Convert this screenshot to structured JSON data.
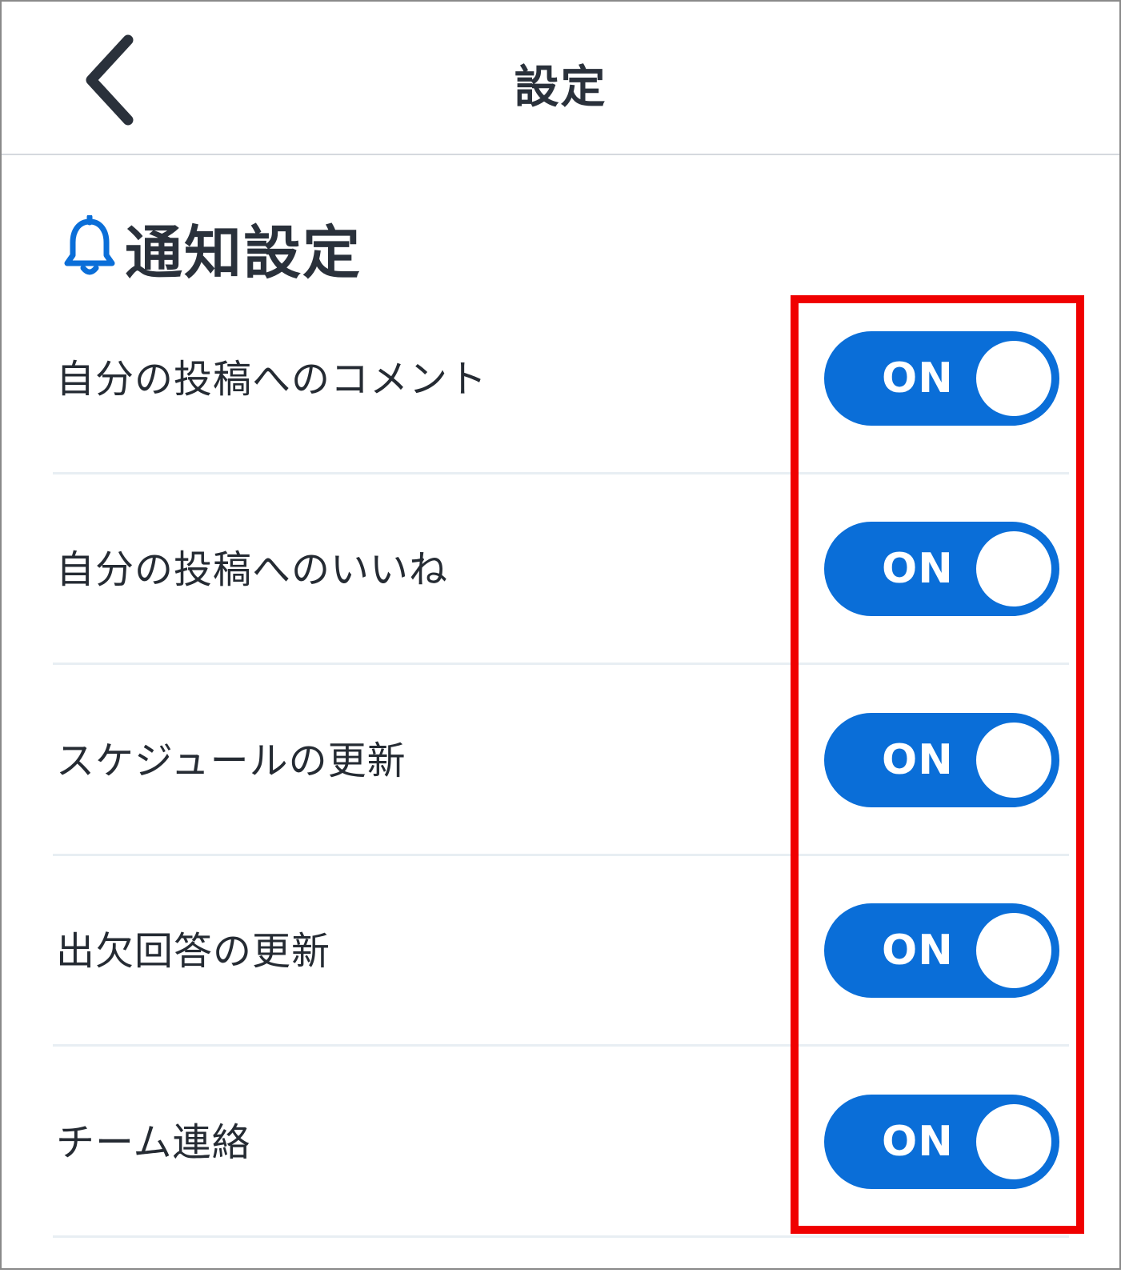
{
  "header": {
    "title": "設定",
    "back_icon": "chevron-left-icon"
  },
  "section": {
    "icon": "bell-icon",
    "title": "通知設定"
  },
  "colors": {
    "accent": "#0a6ed8",
    "highlight": "#f00000",
    "text": "#252b33",
    "divider": "#e8eef3"
  },
  "settings": [
    {
      "label": "自分の投稿へのコメント",
      "toggle": "ON"
    },
    {
      "label": "自分の投稿へのいいね",
      "toggle": "ON"
    },
    {
      "label": "スケジュールの更新",
      "toggle": "ON"
    },
    {
      "label": "出欠回答の更新",
      "toggle": "ON"
    },
    {
      "label": "チーム連絡",
      "toggle": "ON"
    }
  ]
}
